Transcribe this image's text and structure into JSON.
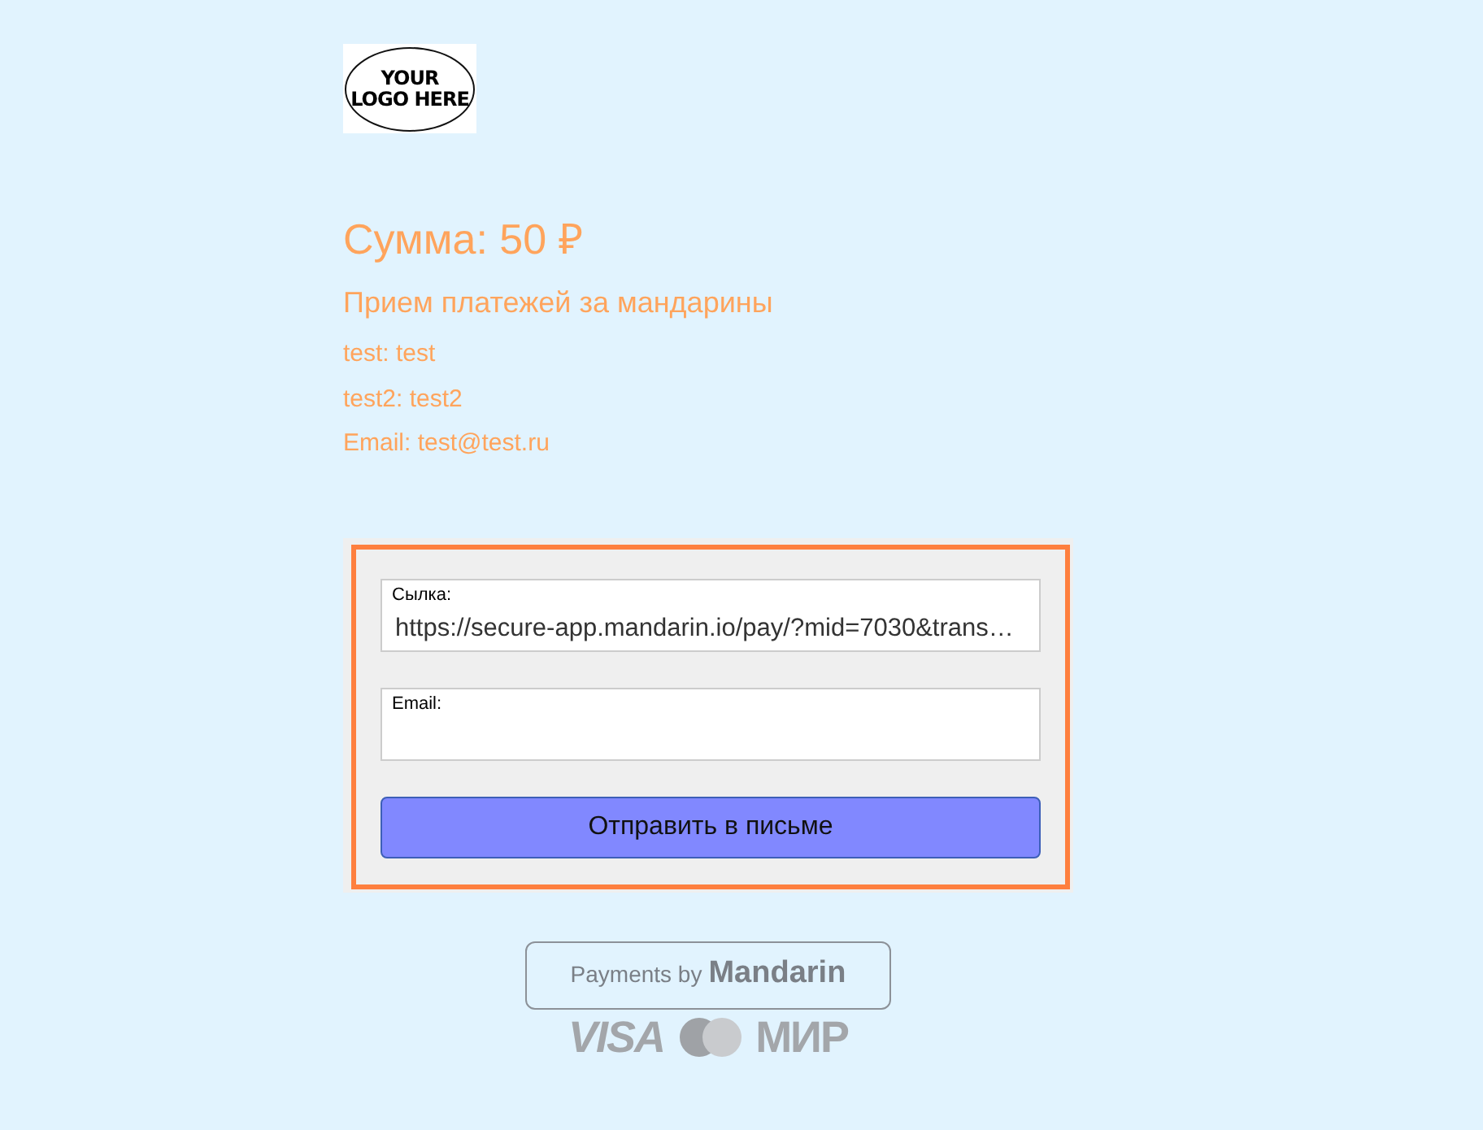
{
  "logo": {
    "line_1": "YOUR",
    "line_2": "LOGO HERE"
  },
  "amount": "Сумма: 50 ₽",
  "description": "Прием платежей за мандарины",
  "details": [
    "test: test",
    "test2: test2",
    "Email: test@test.ru"
  ],
  "form": {
    "fields": [
      {
        "label": "Сылка:",
        "value": "https://secure-app.mandarin.io/pay/?mid=7030&trans…"
      },
      {
        "label": "Email:"
      }
    ],
    "button": "Отправить в письме"
  },
  "footer": {
    "payments_by": "Payments by",
    "brand": "Mandarin",
    "cards": [
      "VISA",
      "МИР"
    ]
  }
}
